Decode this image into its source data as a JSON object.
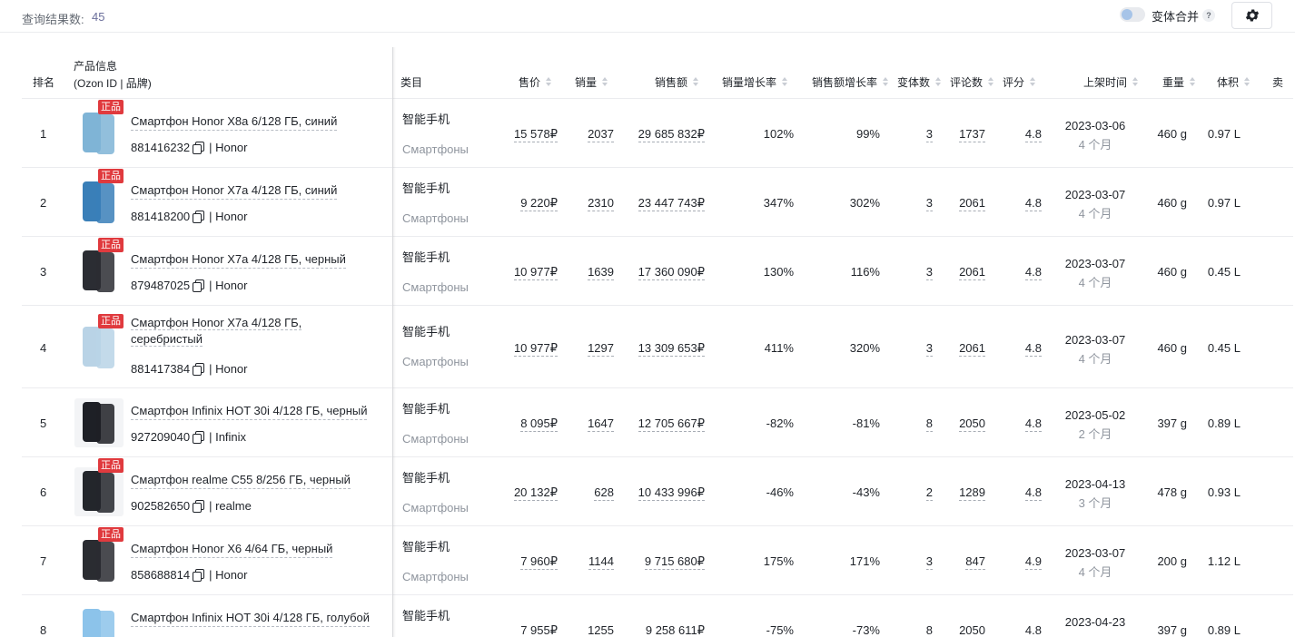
{
  "header": {
    "count_label": "查询结果数:",
    "count_value": "45",
    "merge_label": "变体合并",
    "help": "?"
  },
  "columns": {
    "rank": "排名",
    "product_line1": "产品信息",
    "product_line2": "(Ozon ID | 品牌)",
    "category": "类目",
    "price": "售价",
    "sales": "销量",
    "revenue": "销售额",
    "sales_growth": "销量增长率",
    "revenue_growth": "销售额增长率",
    "variants": "变体数",
    "reviews": "评论数",
    "rating": "评分",
    "listed": "上架时间",
    "weight": "重量",
    "volume": "体积",
    "seller": "卖"
  },
  "rows": [
    {
      "rank": "1",
      "badge": "正品",
      "title": "Смартфон Honor X8a 6/128 ГБ, синий",
      "title_line2": "",
      "id": "881416232",
      "brand": "Honor",
      "cat1": "智能手机",
      "cat2": "Смартфоны",
      "price": "15 578₽",
      "sales": "2037",
      "revenue": "29 685 832₽",
      "sales_growth": "102%",
      "revenue_growth": "99%",
      "variants": "3",
      "reviews": "1737",
      "rating": "4.8",
      "date": "2023-03-06",
      "age": "4 个月",
      "weight": "460 g",
      "volume": "0.97 L",
      "phone_color": "#7fb4d6"
    },
    {
      "rank": "2",
      "badge": "正品",
      "title": "Смартфон Honor X7a 4/128 ГБ, синий",
      "title_line2": "",
      "id": "881418200",
      "brand": "Honor",
      "cat1": "智能手机",
      "cat2": "Смартфоны",
      "price": "9 220₽",
      "sales": "2310",
      "revenue": "23 447 743₽",
      "sales_growth": "347%",
      "revenue_growth": "302%",
      "variants": "3",
      "reviews": "2061",
      "rating": "4.8",
      "date": "2023-03-07",
      "age": "4 个月",
      "weight": "460 g",
      "volume": "0.97 L",
      "phone_color": "#3a7fb8"
    },
    {
      "rank": "3",
      "badge": "正品",
      "title": "Смартфон Honor X7a 4/128 ГБ, черный",
      "title_line2": "",
      "id": "879487025",
      "brand": "Honor",
      "cat1": "智能手机",
      "cat2": "Смартфоны",
      "price": "10 977₽",
      "sales": "1639",
      "revenue": "17 360 090₽",
      "sales_growth": "130%",
      "revenue_growth": "116%",
      "variants": "3",
      "reviews": "2061",
      "rating": "4.8",
      "date": "2023-03-07",
      "age": "4 个月",
      "weight": "460 g",
      "volume": "0.45 L",
      "phone_color": "#2b2d33"
    },
    {
      "rank": "4",
      "badge": "正品",
      "title": "Смартфон Honor X7a 4/128 ГБ,",
      "title_line2": "серебристый",
      "id": "881417384",
      "brand": "Honor",
      "cat1": "智能手机",
      "cat2": "Смартфоны",
      "price": "10 977₽",
      "sales": "1297",
      "revenue": "13 309 653₽",
      "sales_growth": "411%",
      "revenue_growth": "320%",
      "variants": "3",
      "reviews": "2061",
      "rating": "4.8",
      "date": "2023-03-07",
      "age": "4 个月",
      "weight": "460 g",
      "volume": "0.45 L",
      "phone_color": "#b9d3e6"
    },
    {
      "rank": "5",
      "badge": "",
      "title": "Смартфон Infinix HOT 30i 4/128 ГБ, черный",
      "title_line2": "",
      "id": "927209040",
      "brand": "Infinix",
      "cat1": "智能手机",
      "cat2": "Смартфоны",
      "price": "8 095₽",
      "sales": "1647",
      "revenue": "12 705 667₽",
      "sales_growth": "-82%",
      "revenue_growth": "-81%",
      "variants": "8",
      "reviews": "2050",
      "rating": "4.8",
      "date": "2023-05-02",
      "age": "2 个月",
      "weight": "397 g",
      "volume": "0.89 L",
      "phone_color": "#1e2026"
    },
    {
      "rank": "6",
      "badge": "正品",
      "title": "Смартфон realme C55 8/256 ГБ, черный",
      "title_line2": "",
      "id": "902582650",
      "brand": "realme",
      "cat1": "智能手机",
      "cat2": "Смартфоны",
      "price": "20 132₽",
      "sales": "628",
      "revenue": "10 433 996₽",
      "sales_growth": "-46%",
      "revenue_growth": "-43%",
      "variants": "2",
      "reviews": "1289",
      "rating": "4.8",
      "date": "2023-04-13",
      "age": "3 个月",
      "weight": "478 g",
      "volume": "0.93 L",
      "phone_color": "#23262b"
    },
    {
      "rank": "7",
      "badge": "正品",
      "title": "Смартфон Honor X6 4/64 ГБ, черный",
      "title_line2": "",
      "id": "858688814",
      "brand": "Honor",
      "cat1": "智能手机",
      "cat2": "Смартфоны",
      "price": "7 960₽",
      "sales": "1144",
      "revenue": "9 715 680₽",
      "sales_growth": "175%",
      "revenue_growth": "171%",
      "variants": "3",
      "reviews": "847",
      "rating": "4.9",
      "date": "2023-03-07",
      "age": "4 个月",
      "weight": "200 g",
      "volume": "1.12 L",
      "phone_color": "#2a2c31"
    },
    {
      "rank": "8",
      "badge": "",
      "title": "Смартфон Infinix HOT 30i 4/128 ГБ, голубой",
      "title_line2": "",
      "id": "",
      "brand": "",
      "cat1": "智能手机",
      "cat2": "",
      "price": "7 955₽",
      "sales": "1255",
      "revenue": "9 258 611₽",
      "sales_growth": "-75%",
      "revenue_growth": "-73%",
      "variants": "8",
      "reviews": "2050",
      "rating": "4.8",
      "date": "2023-04-23",
      "age": "",
      "weight": "397 g",
      "volume": "0.89 L",
      "phone_color": "#8cc3ea"
    }
  ]
}
